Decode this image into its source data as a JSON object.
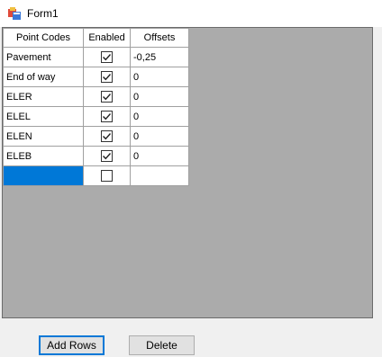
{
  "window": {
    "title": "Form1",
    "icon": "form-app-icon"
  },
  "grid": {
    "headers": [
      "Point Codes",
      "Enabled",
      "Offsets"
    ],
    "rows": [
      {
        "code": "Pavement",
        "enabled": true,
        "offset": "-0,25"
      },
      {
        "code": "End of way",
        "enabled": true,
        "offset": "0"
      },
      {
        "code": "ELER",
        "enabled": true,
        "offset": "0"
      },
      {
        "code": "ELEL",
        "enabled": true,
        "offset": "0"
      },
      {
        "code": "ELEN",
        "enabled": true,
        "offset": "0"
      },
      {
        "code": "ELEB",
        "enabled": true,
        "offset": "0"
      },
      {
        "code": "",
        "enabled": false,
        "offset": ""
      }
    ]
  },
  "buttons": {
    "add_rows": "Add Rows",
    "delete": "Delete"
  },
  "colors": {
    "selection": "#0078d7",
    "grid_background": "#ababab"
  }
}
